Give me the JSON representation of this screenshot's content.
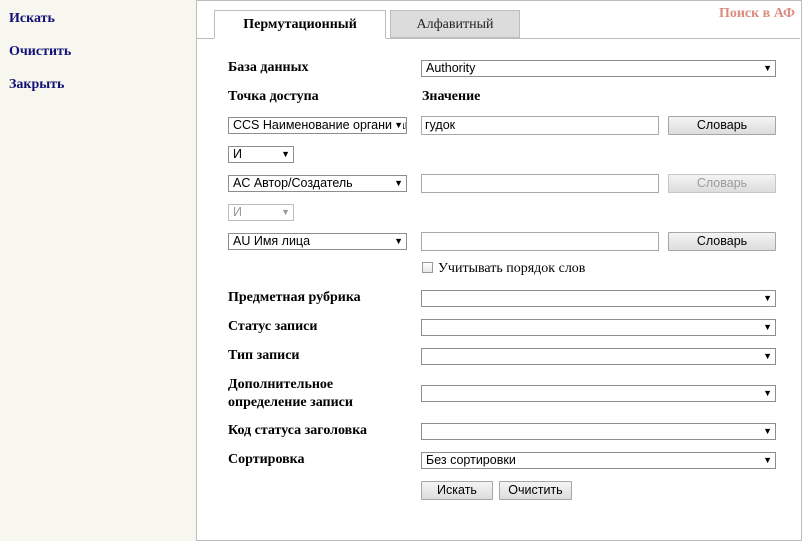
{
  "sidebar": {
    "search": "Искать",
    "clear": "Очистить",
    "close": "Закрыть"
  },
  "title": "Поиск в АФ",
  "tabs": [
    {
      "label": "Пермутационный",
      "active": true
    },
    {
      "label": "Алфавитный",
      "active": false
    }
  ],
  "form": {
    "database_label": "База данных",
    "database_value": "Authority",
    "access_point_header": "Точка доступа",
    "value_header": "Значение",
    "rows": [
      {
        "access_point": "CCS Наименование организации",
        "value": "гудок",
        "dict_label": "Словарь",
        "dict_enabled": true
      },
      {
        "access_point": "AC Автор/Создатель",
        "value": "",
        "dict_label": "Словарь",
        "dict_enabled": false
      },
      {
        "access_point": "AU Имя лица",
        "value": "",
        "dict_label": "Словарь",
        "dict_enabled": true
      }
    ],
    "operators": [
      {
        "value": "И",
        "enabled": true
      },
      {
        "value": "И",
        "enabled": false
      }
    ],
    "word_order_label": "Учитывать порядок слов",
    "word_order_checked": false,
    "subject_label": "Предметная рубрика",
    "status_label": "Статус записи",
    "type_label": "Тип записи",
    "extra_label_line1": "Дополнительное",
    "extra_label_line2": "определение записи",
    "heading_status_label": "Код статуса заголовка",
    "sort_label": "Сортировка",
    "sort_value": "Без сортировки",
    "search_button": "Искать",
    "clear_button": "Очистить"
  }
}
